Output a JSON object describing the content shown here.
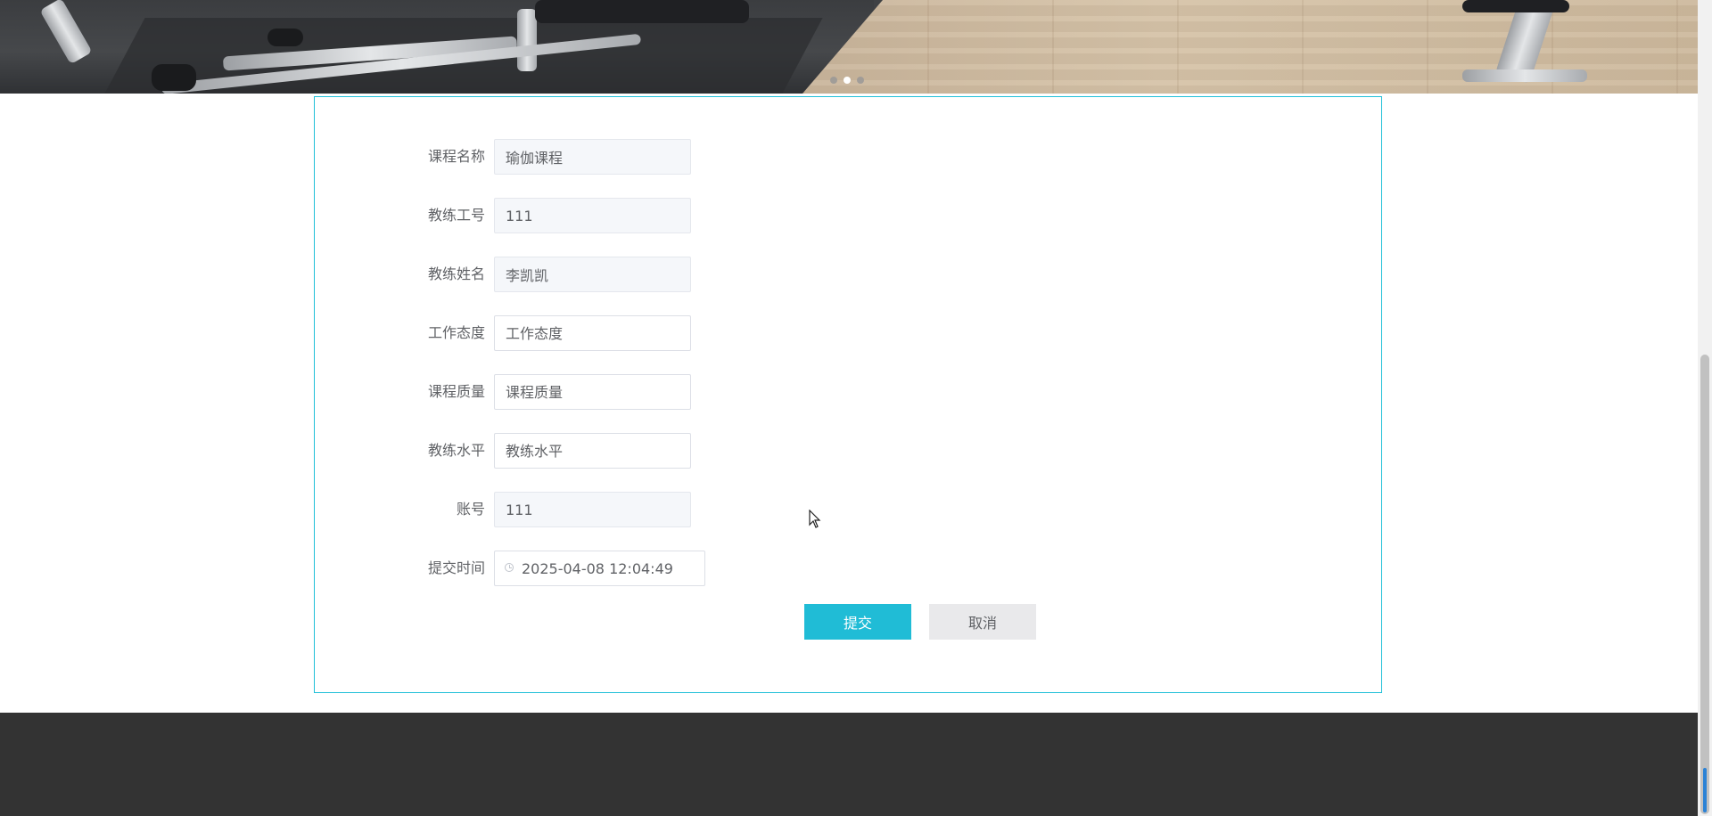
{
  "form": {
    "fields": [
      {
        "label": "课程名称",
        "value": "瑜伽课程",
        "placeholder": "",
        "disabled": true
      },
      {
        "label": "教练工号",
        "value": "111",
        "placeholder": "",
        "disabled": true
      },
      {
        "label": "教练姓名",
        "value": "李凯凯",
        "placeholder": "",
        "disabled": true
      },
      {
        "label": "工作态度",
        "value": "",
        "placeholder": "工作态度",
        "disabled": false
      },
      {
        "label": "课程质量",
        "value": "",
        "placeholder": "课程质量",
        "disabled": false
      },
      {
        "label": "教练水平",
        "value": "",
        "placeholder": "教练水平",
        "disabled": false
      },
      {
        "label": "账号",
        "value": "111",
        "placeholder": "",
        "disabled": true
      }
    ],
    "submit_time": {
      "label": "提交时间",
      "value": "2025-04-08 12:04:49",
      "icon": "clock-icon"
    },
    "submit_label": "提交",
    "cancel_label": "取消"
  },
  "banner": {
    "slides": 3,
    "active_slide": 2
  },
  "colors": {
    "accent": "#20bcd6",
    "border": "#20c0d8",
    "footer": "#333333"
  }
}
